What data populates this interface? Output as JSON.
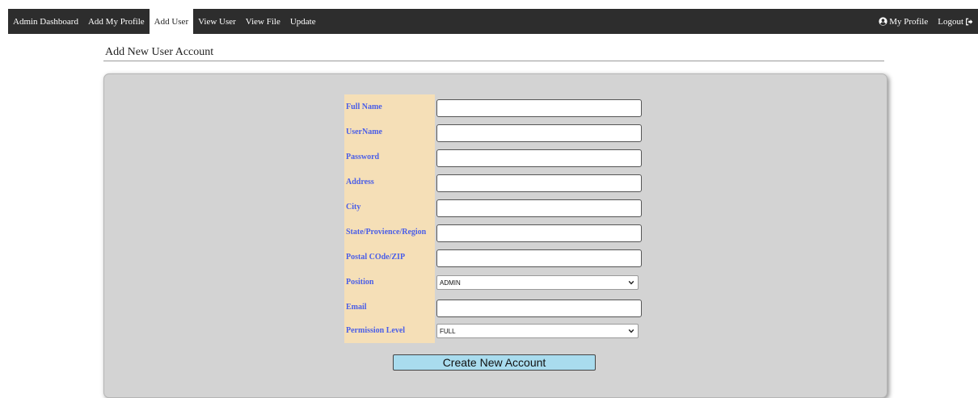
{
  "nav": {
    "items": [
      {
        "label": "Admin Dashboard",
        "active": false
      },
      {
        "label": "Add My Profile",
        "active": false
      },
      {
        "label": "Add User",
        "active": true
      },
      {
        "label": "View User",
        "active": false
      },
      {
        "label": "View File",
        "active": false
      },
      {
        "label": "Update",
        "active": false
      }
    ],
    "my_profile": {
      "label": "My Profile",
      "icon": "user-circle-icon"
    },
    "logout": {
      "label": "Logout",
      "icon": "sign-out-icon"
    }
  },
  "page": {
    "title": "Add New User Account"
  },
  "form": {
    "fields": [
      {
        "label": "Full Name",
        "type": "text",
        "value": ""
      },
      {
        "label": "UserName",
        "type": "text",
        "value": ""
      },
      {
        "label": "Password",
        "type": "text",
        "value": ""
      },
      {
        "label": "Address",
        "type": "text",
        "value": ""
      },
      {
        "label": "City",
        "type": "text",
        "value": ""
      },
      {
        "label": "State/Provience/Region",
        "type": "text",
        "value": ""
      },
      {
        "label": "Postal COde/ZIP",
        "type": "text",
        "value": ""
      },
      {
        "label": "Position",
        "type": "select",
        "value": "ADMIN"
      },
      {
        "label": "Email",
        "type": "text",
        "value": ""
      },
      {
        "label": "Permission Level",
        "type": "select",
        "value": "FULL"
      }
    ],
    "submit_label": "Create New Account"
  },
  "colors": {
    "navbar_bg": "#2d2d2d",
    "label_bg": "#f5dfb7",
    "label_text": "#4a5ee8",
    "panel_bg": "#d3d3d3",
    "button_bg": "#a9dcee"
  }
}
